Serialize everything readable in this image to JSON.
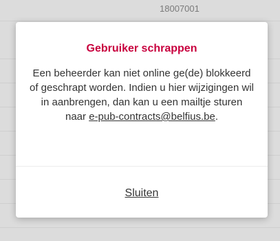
{
  "background": {
    "cell_value": "18007001"
  },
  "modal": {
    "title": "Gebruiker schrappen",
    "message_before_link": "Een beheerder kan niet online ge(de) blokkeerd of geschrapt worden. Indien u hier wijzigingen wil in aanbrengen, dan kan u een mailtje sturen naar ",
    "email_link": "e-pub-contracts@belfius.be",
    "message_after_link": ".",
    "close_label": "Sluiten"
  },
  "colors": {
    "accent": "#c8003e",
    "overlay": "#dcdcdc",
    "text": "#333333"
  }
}
